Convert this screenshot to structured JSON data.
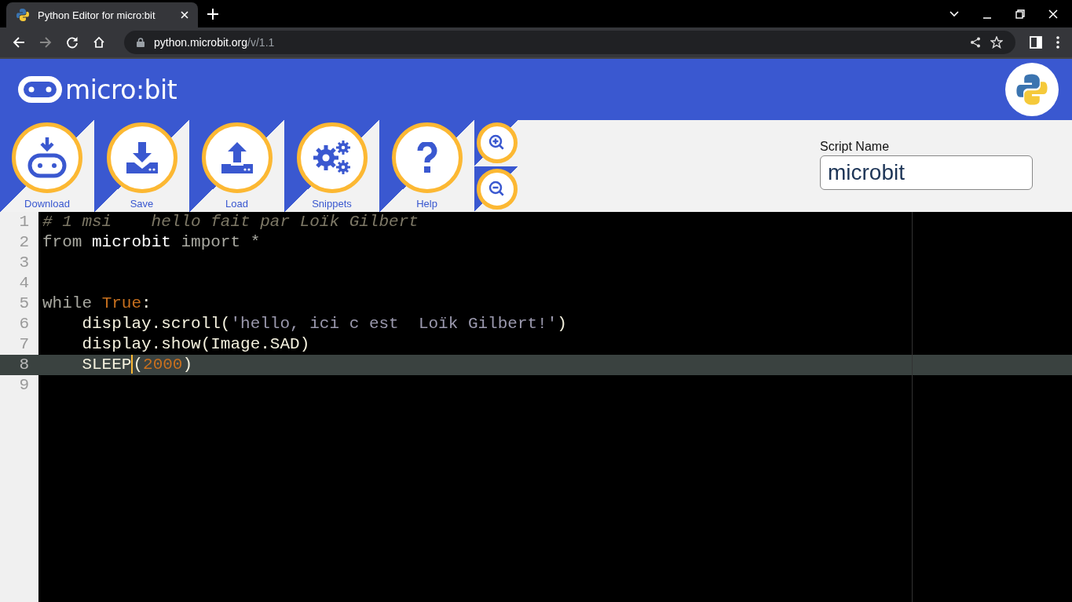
{
  "browser": {
    "tab_title": "Python Editor for micro:bit",
    "url_host": "python.microbit.org",
    "url_path": "/v/1.1"
  },
  "header": {
    "logo_text": "micro:bit"
  },
  "toolbar": [
    {
      "kind": "download",
      "label": "Download"
    },
    {
      "kind": "save",
      "label": "Save"
    },
    {
      "kind": "load",
      "label": "Load"
    },
    {
      "kind": "snippets",
      "label": "Snippets"
    },
    {
      "kind": "help",
      "label": "Help"
    }
  ],
  "script_name": {
    "label": "Script Name",
    "value": "microbit"
  },
  "editor": {
    "lines": [
      {
        "number": "1",
        "active": false,
        "tokens": [
          {
            "kind": "comment",
            "text": "# 1 msi    hello fait par Loïk Gilbert"
          }
        ]
      },
      {
        "number": "2",
        "active": false,
        "tokens": [
          {
            "kind": "keyword",
            "text": "from "
          },
          {
            "kind": "name",
            "text": "microbit"
          },
          {
            "kind": "keyword",
            "text": " import *"
          }
        ]
      },
      {
        "number": "3",
        "active": false
      },
      {
        "number": "4",
        "active": false
      },
      {
        "number": "5",
        "active": false,
        "tokens": [
          {
            "kind": "keyword",
            "text": "while "
          },
          {
            "kind": "const",
            "text": "True"
          },
          {
            "kind": "plain",
            "text": ":"
          }
        ]
      },
      {
        "number": "6",
        "active": false,
        "tokens": [
          {
            "kind": "plain",
            "text": "    display.scroll("
          },
          {
            "kind": "string",
            "text": "'hello, ici c est  Loïk Gilbert!'"
          },
          {
            "kind": "plain",
            "text": ")"
          }
        ]
      },
      {
        "number": "7",
        "active": false,
        "tokens": [
          {
            "kind": "plain",
            "text": "    display.show(Image.SAD)"
          }
        ]
      },
      {
        "number": "8",
        "active": true,
        "tokens": [
          {
            "kind": "plain",
            "text": "    SLEEP",
            "cursor": true
          },
          {
            "kind": "plain",
            "text": "("
          },
          {
            "kind": "number",
            "text": "2000"
          },
          {
            "kind": "plain",
            "text": ")"
          }
        ]
      },
      {
        "number": "9",
        "active": false
      }
    ]
  }
}
